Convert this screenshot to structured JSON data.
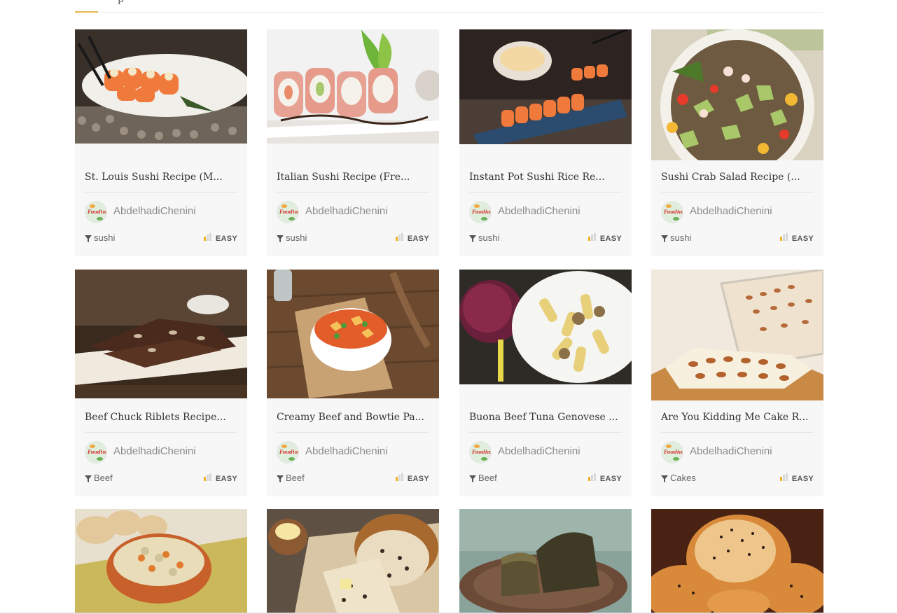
{
  "header": {
    "partial_text": "p"
  },
  "colors": {
    "accent": "#e8b84a",
    "difficulty_bar_on": "#f0b229",
    "difficulty_bar_off": "#d8d8d8"
  },
  "cards": [
    {
      "title": "St. Louis Sushi Recipe (M...",
      "author": "AbdelhadiChenini",
      "category": "sushi",
      "difficulty": "EASY",
      "image": "sushi-rolls-photo"
    },
    {
      "title": "Italian Sushi Recipe (Fre...",
      "author": "AbdelhadiChenini",
      "category": "sushi",
      "difficulty": "EASY",
      "image": "prosciutto-sushi-photo"
    },
    {
      "title": "Instant Pot Sushi Rice Re...",
      "author": "AbdelhadiChenini",
      "category": "sushi",
      "difficulty": "EASY",
      "image": "sushi-platter-photo"
    },
    {
      "title": "Sushi Crab Salad Recipe (...",
      "author": "AbdelhadiChenini",
      "category": "sushi",
      "difficulty": "EASY",
      "image": "crab-salad-photo"
    },
    {
      "title": "Beef Chuck Riblets Recipe...",
      "author": "AbdelhadiChenini",
      "category": "Beef",
      "difficulty": "EASY",
      "image": "beef-riblets-photo"
    },
    {
      "title": "Creamy Beef and Bowtie Pa...",
      "author": "AbdelhadiChenini",
      "category": "Beef",
      "difficulty": "EASY",
      "image": "bowtie-pasta-photo"
    },
    {
      "title": "Buona Beef Tuna Genovese ...",
      "author": "AbdelhadiChenini",
      "category": "Beef",
      "difficulty": "EASY",
      "image": "genovese-pasta-photo"
    },
    {
      "title": "Are You Kidding Me Cake R...",
      "author": "AbdelhadiChenini",
      "category": "Cakes",
      "difficulty": "EASY",
      "image": "pecan-cake-photo"
    },
    {
      "image": "chicken-soup-photo"
    },
    {
      "image": "olive-bread-photo"
    },
    {
      "image": "dark-bread-photo"
    },
    {
      "image": "challah-bread-photo"
    }
  ]
}
